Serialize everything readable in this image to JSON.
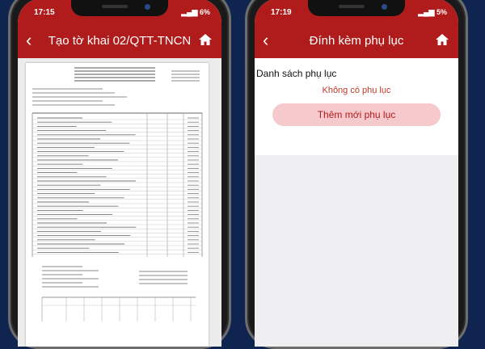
{
  "left_phone": {
    "status": {
      "time": "17:15",
      "icons": "▴ •",
      "battery": "6%"
    },
    "appbar": {
      "title": "Tạo tờ khai 02/QTT-TNCN"
    }
  },
  "right_phone": {
    "status": {
      "time": "17:19",
      "icons": "★ •",
      "battery": "5%"
    },
    "appbar": {
      "title": "Đính kèm phụ lục"
    },
    "section": {
      "title": "Danh sách phụ lục",
      "empty_message": "Không có phụ lục",
      "add_button": "Thêm mới phụ lục"
    }
  },
  "colors": {
    "brand_red": "#b01b1b",
    "button_bg": "#f6c9cc"
  }
}
